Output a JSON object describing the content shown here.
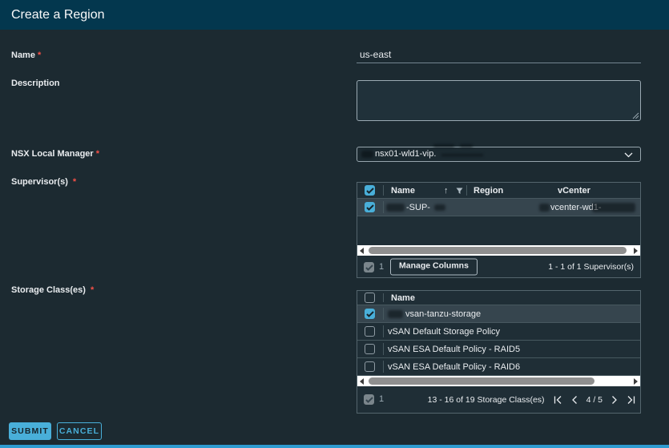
{
  "header": {
    "title": "Create a Region"
  },
  "required_marker": "*",
  "form": {
    "name": {
      "label": "Name",
      "value": "us-east"
    },
    "description": {
      "label": "Description",
      "value": ""
    },
    "nsx": {
      "label": "NSX Local Manager",
      "value": "nsx01-wld1-vip."
    },
    "supervisors": {
      "label": "Supervisor(s)",
      "columns": {
        "name": "Name",
        "region": "Region",
        "vcenter": "vCenter"
      },
      "rows": [
        {
          "name": "-SUP-",
          "region": "",
          "vcenter": "vcenter-wd1-",
          "checked": true
        }
      ],
      "footer": {
        "selected": "1",
        "manage_columns": "Manage Columns",
        "range": "1 - 1 of 1 Supervisor(s)"
      }
    },
    "storage": {
      "label": "Storage Class(es)",
      "columns": {
        "name": "Name"
      },
      "rows": [
        {
          "name": "vsan-tanzu-storage",
          "checked": true
        },
        {
          "name": "vSAN Default Storage Policy",
          "checked": false
        },
        {
          "name": "vSAN ESA Default Policy - RAID5",
          "checked": false
        },
        {
          "name": "vSAN ESA Default Policy - RAID6",
          "checked": false
        }
      ],
      "footer": {
        "selected": "1",
        "range": "13 - 16 of 19 Storage Class(es)",
        "page": "4 / 5"
      }
    }
  },
  "actions": {
    "submit": "SUBMIT",
    "cancel": "CANCEL"
  },
  "icons": {
    "sort_ascending": "↑",
    "filter": "funnel",
    "chevron_down": "⌄",
    "scroll_left": "◄",
    "scroll_right": "►",
    "page_first": "|<",
    "page_prev": "<",
    "page_next": ">",
    "page_last": ">|",
    "check": "✓"
  },
  "colors": {
    "accent": "#49afd9",
    "header_bg": "#03374e",
    "body_bg": "#1c2a31",
    "selected_row": "#36454e",
    "table_border": "#54656d",
    "bottom_strip": "#2e9bd0",
    "required": "#f55047"
  }
}
